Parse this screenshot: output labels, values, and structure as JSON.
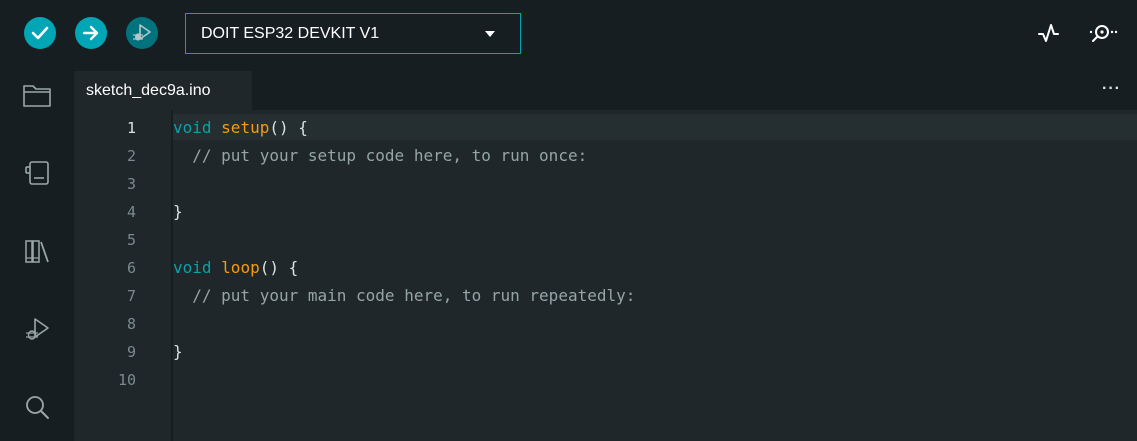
{
  "toolbar": {
    "board_name": "DOIT ESP32 DEVKIT V1",
    "verify_icon": "checkmark-icon",
    "upload_icon": "arrow-right-icon",
    "debug_icon": "debug-icon",
    "plotter_icon": "serial-plotter-icon",
    "monitor_icon": "serial-monitor-icon"
  },
  "sidebar": {
    "items": [
      {
        "icon": "folder-icon"
      },
      {
        "icon": "board-manager-icon"
      },
      {
        "icon": "library-icon"
      },
      {
        "icon": "debug-icon"
      },
      {
        "icon": "search-icon"
      }
    ]
  },
  "tab": {
    "filename": "sketch_dec9a.ino",
    "more_label": "···"
  },
  "editor": {
    "line_numbers": [
      "1",
      "2",
      "3",
      "4",
      "5",
      "6",
      "7",
      "8",
      "9",
      "10"
    ],
    "lines": [
      {
        "keyword": "void",
        "fn": "setup",
        "rest": "() {"
      },
      {
        "comment": "  // put your setup code here, to run once:"
      },
      {},
      {
        "rest": "}"
      },
      {},
      {
        "keyword": "void",
        "fn": "loop",
        "rest": "() {"
      },
      {
        "comment": "  // put your main code here, to run repeatedly:"
      },
      {},
      {
        "rest": "}"
      },
      {}
    ]
  },
  "colors": {
    "accent": "#00a6b5",
    "background": "#171e21",
    "editor_bg": "#1f272a",
    "keyword": "#0ca1a6",
    "function": "#f39c12",
    "comment": "#95a5a6"
  }
}
